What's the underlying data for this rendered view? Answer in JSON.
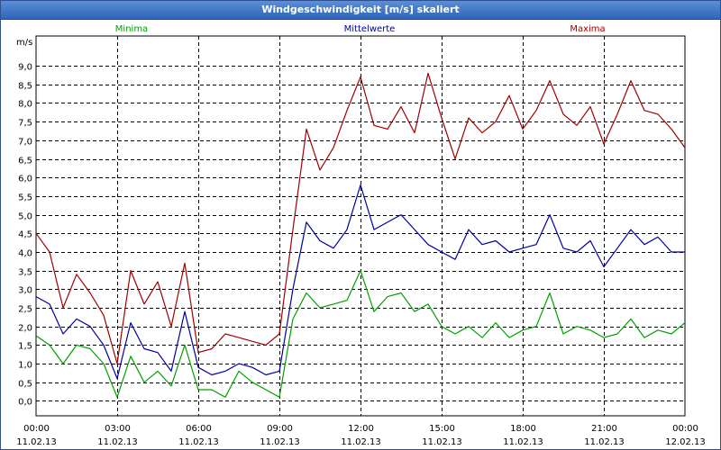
{
  "window": {
    "title": "Windgeschwindigkeit [m/s] skaliert"
  },
  "colors": {
    "title_bg": "#3b73c8",
    "grid": "#000000",
    "minima": "#00a000",
    "mittelwerte": "#0000a0",
    "maxima": "#a00000"
  },
  "chart_data": {
    "type": "line",
    "title": "Windgeschwindigkeit [m/s] skaliert",
    "ylabel": "m/s",
    "xlabel": "",
    "ylim": [
      -0.4,
      9.8
    ],
    "xlim": [
      0,
      24
    ],
    "grid": true,
    "legend_placement": "top",
    "y_ticks": [
      "0,0",
      "0,5",
      "1,0",
      "1,5",
      "2,0",
      "2,5",
      "3,0",
      "3,5",
      "4,0",
      "4,5",
      "5,0",
      "5,5",
      "6,0",
      "6,5",
      "7,0",
      "7,5",
      "8,0",
      "8,5",
      "9,0"
    ],
    "y_tick_values": [
      0,
      0.5,
      1,
      1.5,
      2,
      2.5,
      3,
      3.5,
      4,
      4.5,
      5,
      5.5,
      6,
      6.5,
      7,
      7.5,
      8,
      8.5,
      9
    ],
    "x_ticks": [
      {
        "time": "00:00",
        "date": "11.02.13"
      },
      {
        "time": "03:00",
        "date": "11.02.13"
      },
      {
        "time": "06:00",
        "date": "11.02.13"
      },
      {
        "time": "09:00",
        "date": "11.02.13"
      },
      {
        "time": "12:00",
        "date": "11.02.13"
      },
      {
        "time": "15:00",
        "date": "11.02.13"
      },
      {
        "time": "18:00",
        "date": "11.02.13"
      },
      {
        "time": "21:00",
        "date": "11.02.13"
      },
      {
        "time": "00:00",
        "date": "12.02.13"
      }
    ],
    "x": [
      0.0,
      0.5,
      1.0,
      1.5,
      2.0,
      2.5,
      3.0,
      3.5,
      4.0,
      4.5,
      5.0,
      5.5,
      6.0,
      6.5,
      7.0,
      7.5,
      8.0,
      8.5,
      9.0,
      9.5,
      10.0,
      10.5,
      11.0,
      11.5,
      12.0,
      12.5,
      13.0,
      13.5,
      14.0,
      14.5,
      15.0,
      15.5,
      16.0,
      16.5,
      17.0,
      17.5,
      18.0,
      18.5,
      19.0,
      19.5,
      20.0,
      20.5,
      21.0,
      21.5,
      22.0,
      22.5,
      23.0,
      23.5,
      24.0
    ],
    "series": [
      {
        "name": "Minima",
        "color": "#00a000",
        "values": [
          1.75,
          1.5,
          1.0,
          1.5,
          1.4,
          1.0,
          0.1,
          1.2,
          0.5,
          0.8,
          0.4,
          1.5,
          0.3,
          0.3,
          0.1,
          0.8,
          0.5,
          0.3,
          0.1,
          2.2,
          2.9,
          2.5,
          2.6,
          2.7,
          3.5,
          2.4,
          2.8,
          2.9,
          2.4,
          2.6,
          2.0,
          1.8,
          2.0,
          1.7,
          2.1,
          1.7,
          1.9,
          2.0,
          2.9,
          1.8,
          2.0,
          1.9,
          1.7,
          1.8,
          2.2,
          1.7,
          1.9,
          1.8,
          2.1
        ]
      },
      {
        "name": "Mittelwerte",
        "color": "#0000a0",
        "values": [
          2.8,
          2.6,
          1.8,
          2.2,
          2.0,
          1.5,
          0.6,
          2.1,
          1.4,
          1.3,
          0.8,
          2.4,
          0.9,
          0.7,
          0.8,
          1.0,
          0.9,
          0.7,
          0.8,
          3.0,
          4.8,
          4.3,
          4.1,
          4.6,
          5.8,
          4.6,
          4.8,
          5.0,
          4.6,
          4.2,
          4.0,
          3.8,
          4.6,
          4.2,
          4.3,
          4.0,
          4.1,
          4.2,
          5.0,
          4.1,
          4.0,
          4.3,
          3.6,
          4.1,
          4.6,
          4.2,
          4.4,
          4.0,
          4.0
        ]
      },
      {
        "name": "Maxima",
        "color": "#a00000",
        "values": [
          4.5,
          4.0,
          2.5,
          3.4,
          2.9,
          2.3,
          1.0,
          3.5,
          2.6,
          3.2,
          2.0,
          3.7,
          1.3,
          1.4,
          1.8,
          1.7,
          1.6,
          1.5,
          1.8,
          4.6,
          7.3,
          6.2,
          6.8,
          7.8,
          8.7,
          7.4,
          7.3,
          7.9,
          7.2,
          8.8,
          7.6,
          6.5,
          7.6,
          7.2,
          7.5,
          8.2,
          7.3,
          7.8,
          8.6,
          7.7,
          7.4,
          7.9,
          6.9,
          7.7,
          8.6,
          7.8,
          7.7,
          7.3,
          6.8
        ]
      }
    ]
  }
}
